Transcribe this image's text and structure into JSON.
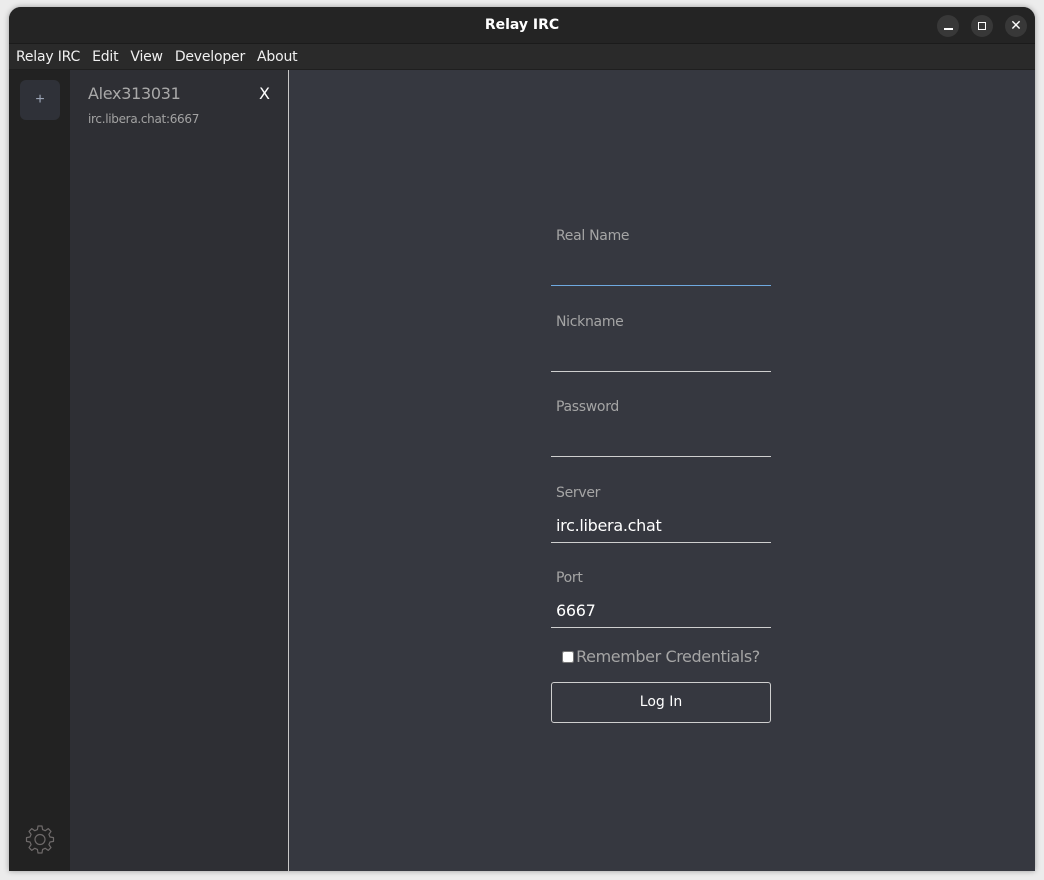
{
  "window": {
    "title": "Relay IRC",
    "controls": {
      "minimize": "minimize",
      "maximize": "maximize",
      "close": "✕"
    }
  },
  "menubar": {
    "items": [
      {
        "label": "Relay IRC"
      },
      {
        "label": "Edit"
      },
      {
        "label": "View"
      },
      {
        "label": "Developer"
      },
      {
        "label": "About"
      }
    ]
  },
  "rail": {
    "add_server_icon": "+",
    "settings_icon": "gear-icon"
  },
  "servers": [
    {
      "nickname": "Alex313031",
      "address": "irc.libera.chat:6667",
      "close_label": "X"
    }
  ],
  "login_form": {
    "fields": [
      {
        "label": "Real Name",
        "value": "",
        "focused": true
      },
      {
        "label": "Nickname",
        "value": ""
      },
      {
        "label": "Password",
        "value": ""
      },
      {
        "label": "Server",
        "value": "irc.libera.chat"
      },
      {
        "label": "Port",
        "value": "6667"
      }
    ],
    "remember_label": "Remember Credentials?",
    "remember_checked": false,
    "submit_label": "Log In"
  },
  "colors": {
    "focus_accent": "#6fa9e0",
    "content_bg": "#363840",
    "sidebar_bg": "#2e2f34",
    "rail_bg": "#222222"
  }
}
